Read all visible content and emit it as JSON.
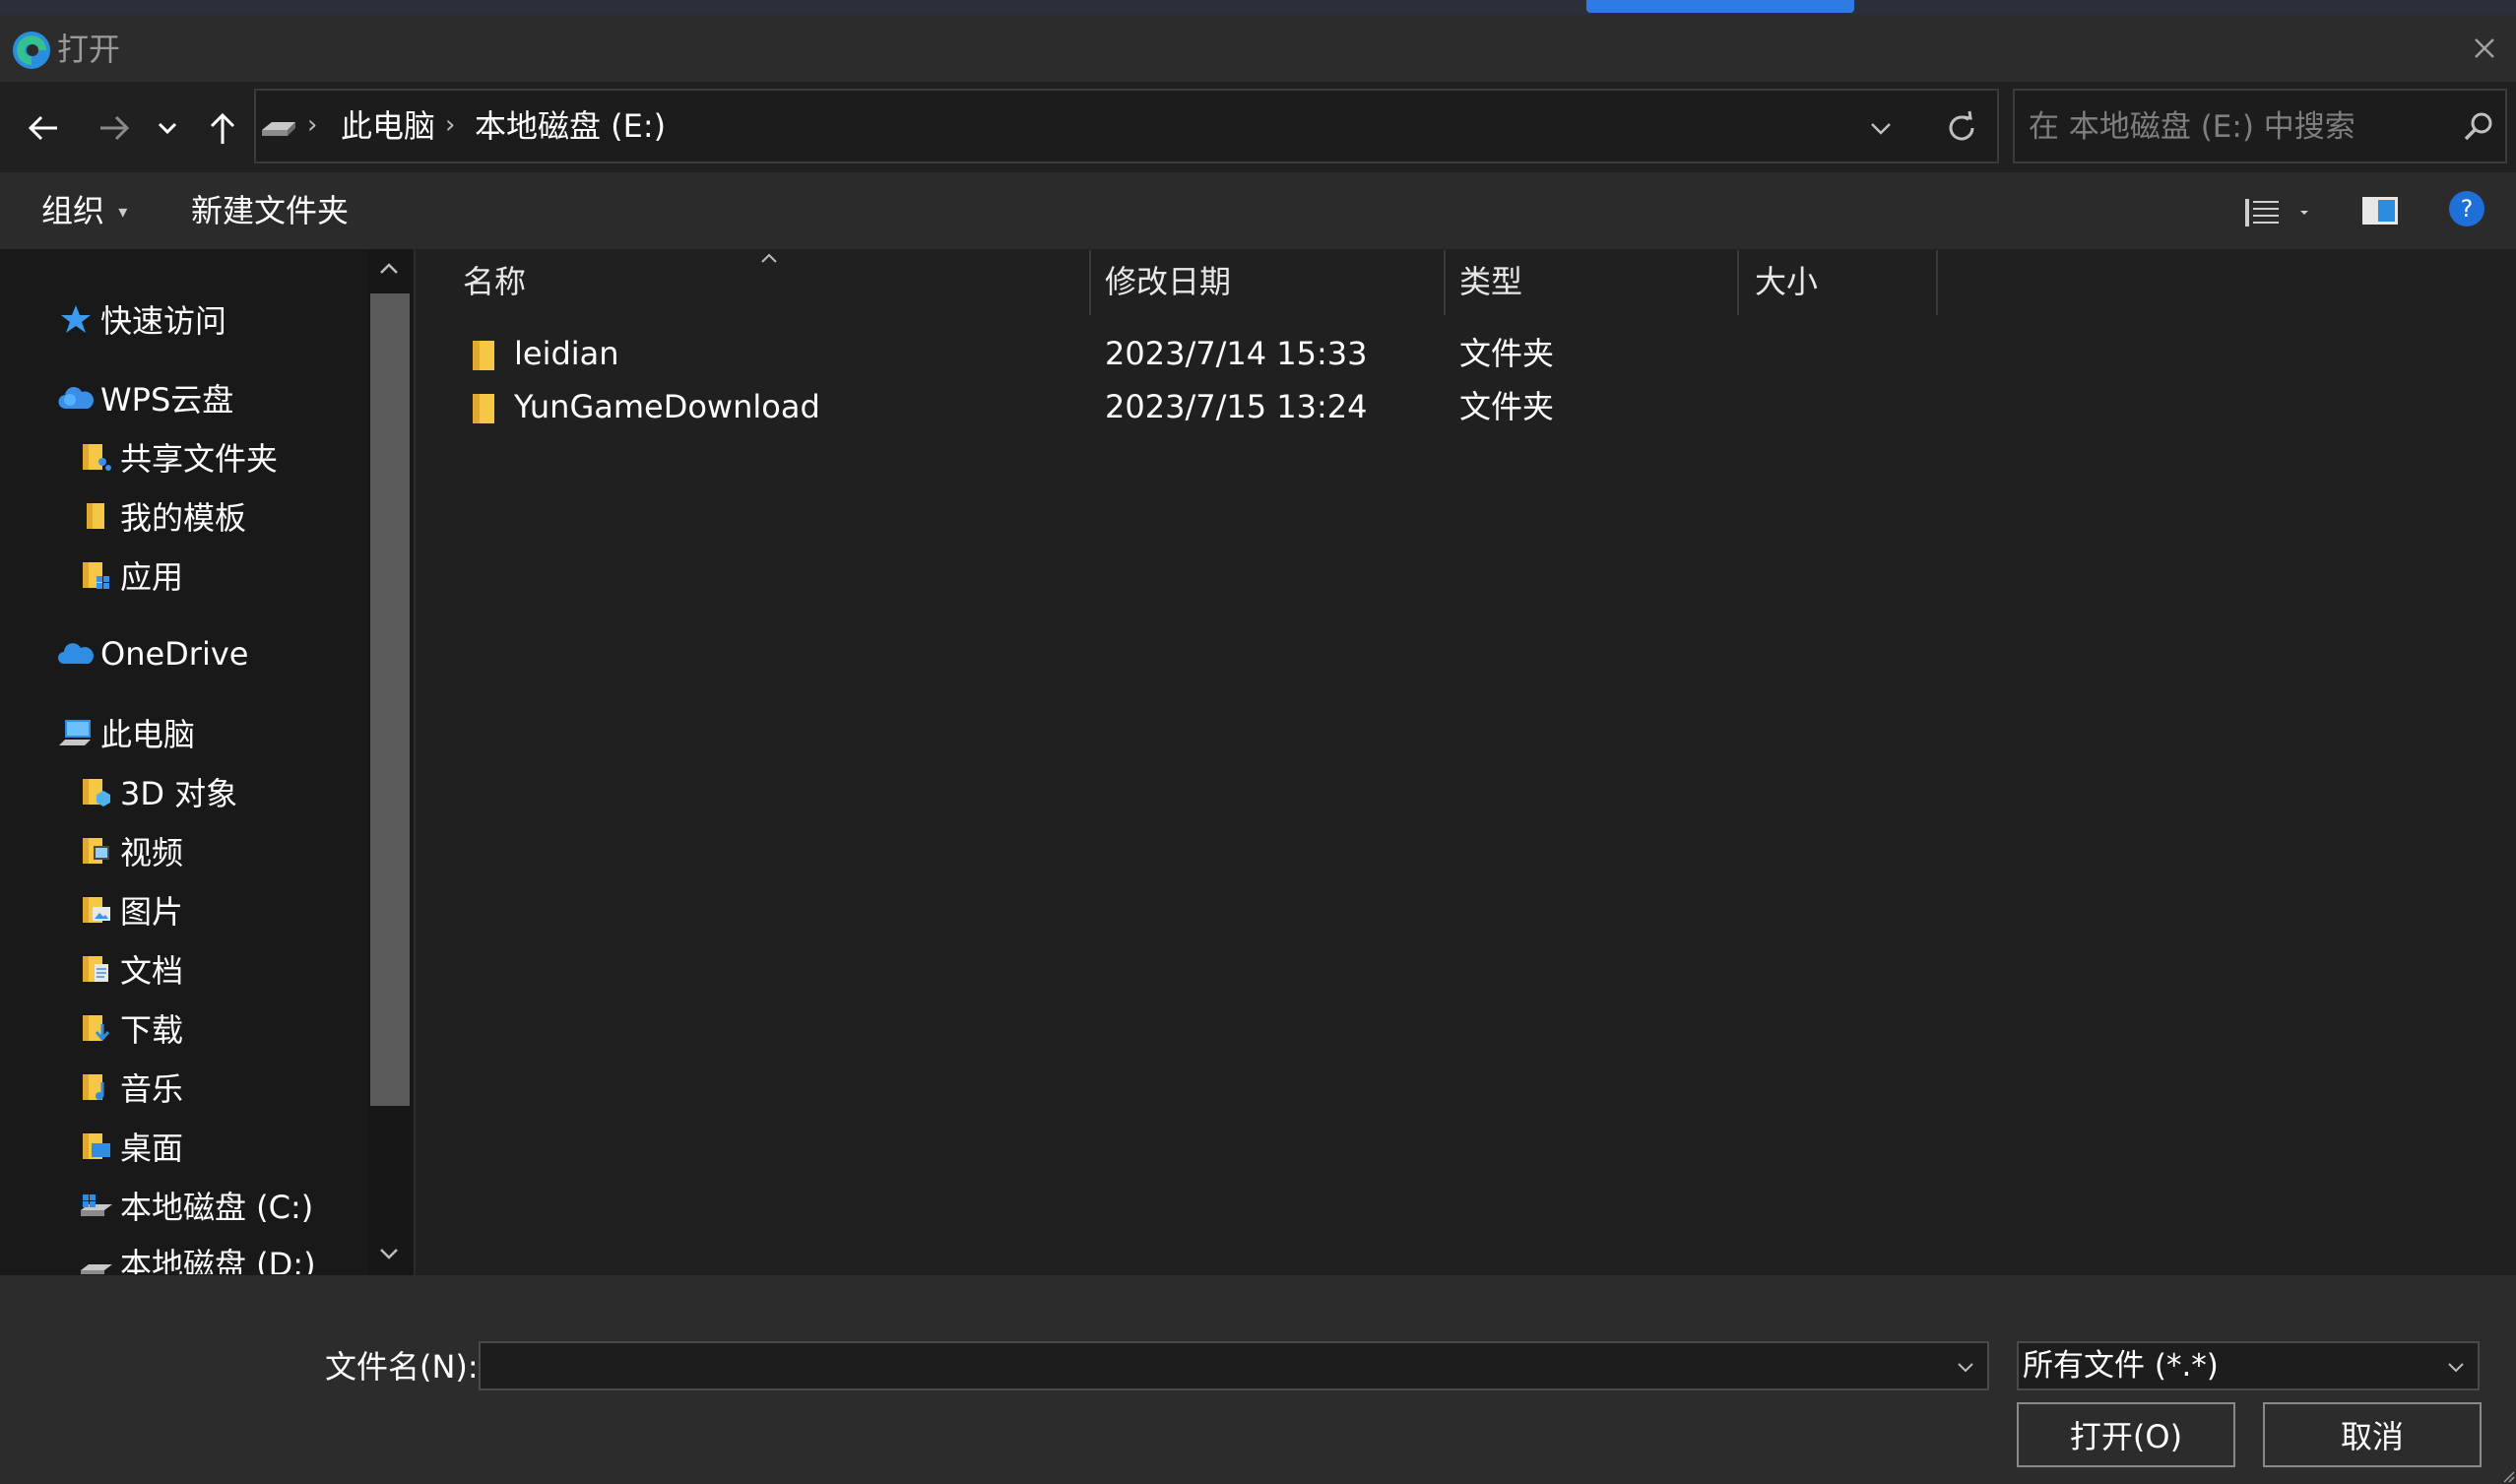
{
  "window": {
    "title": "打开"
  },
  "nav": {
    "back_label": "←",
    "forward_label": "→",
    "recent_label": "⌄",
    "up_label": "↑"
  },
  "address": {
    "crumbs": [
      "此电脑",
      "本地磁盘 (E:)"
    ],
    "separator": "›"
  },
  "search": {
    "placeholder": "在 本地磁盘 (E:) 中搜索"
  },
  "toolbar": {
    "organize_label": "组织",
    "new_folder_label": "新建文件夹"
  },
  "sidebar": {
    "items": [
      {
        "label": "快速访问",
        "icon": "star-icon"
      },
      {
        "label": "WPS云盘",
        "icon": "wps-cloud-icon"
      },
      {
        "label": "共享文件夹",
        "icon": "shared-folder-icon"
      },
      {
        "label": "我的模板",
        "icon": "folder-icon"
      },
      {
        "label": "应用",
        "icon": "app-folder-icon"
      },
      {
        "label": "OneDrive",
        "icon": "onedrive-icon"
      },
      {
        "label": "此电脑",
        "icon": "computer-icon"
      },
      {
        "label": "3D 对象",
        "icon": "3d-objects-icon"
      },
      {
        "label": "视频",
        "icon": "videos-icon"
      },
      {
        "label": "图片",
        "icon": "pictures-icon"
      },
      {
        "label": "文档",
        "icon": "documents-icon"
      },
      {
        "label": "下载",
        "icon": "downloads-icon"
      },
      {
        "label": "音乐",
        "icon": "music-icon"
      },
      {
        "label": "桌面",
        "icon": "desktop-icon"
      },
      {
        "label": "本地磁盘 (C:)",
        "icon": "system-drive-icon"
      },
      {
        "label": "本地磁盘 (D:)",
        "icon": "drive-icon"
      }
    ]
  },
  "columns": {
    "name": "名称",
    "modified": "修改日期",
    "type": "类型",
    "size": "大小"
  },
  "files": [
    {
      "name": "leidian",
      "modified": "2023/7/14 15:33",
      "type": "文件夹",
      "size": ""
    },
    {
      "name": "YunGameDownload",
      "modified": "2023/7/15 13:24",
      "type": "文件夹",
      "size": ""
    }
  ],
  "footer": {
    "filename_label": "文件名(N):",
    "filename_value": "",
    "filetype_selected": "所有文件 (*.*)",
    "open_label": "打开(O)",
    "cancel_label": "取消"
  },
  "colors": {
    "background": "#202020",
    "folder": "#f6c744",
    "accent": "#2f7be6",
    "help": "#1f6fd8"
  }
}
